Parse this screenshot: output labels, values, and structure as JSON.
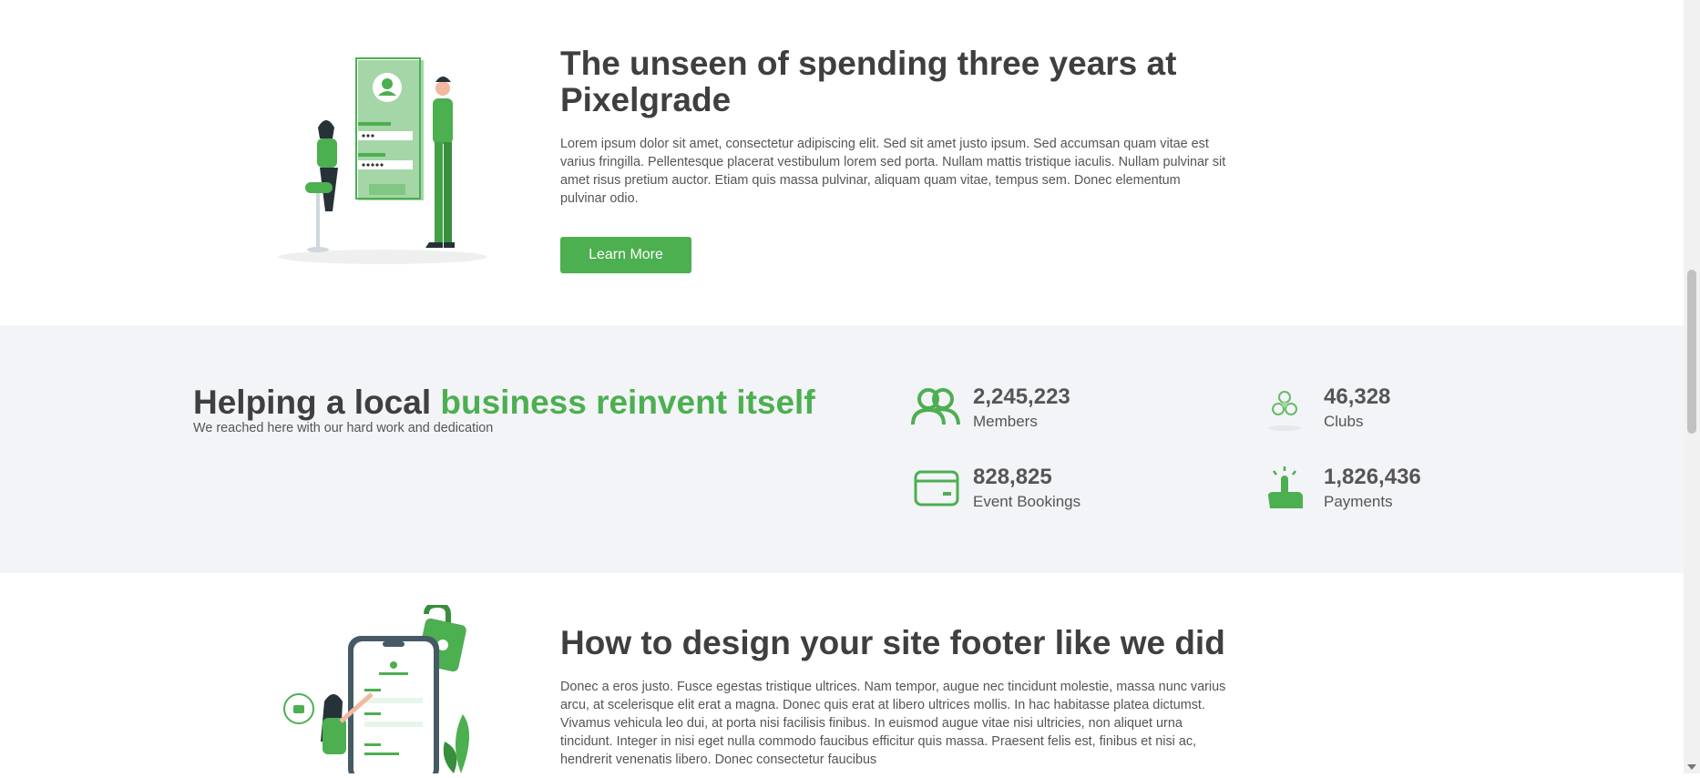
{
  "colors": {
    "accent": "#4caf50",
    "heading": "#3f3f3f",
    "band_bg": "#f3f4f7"
  },
  "section1": {
    "title": "The unseen of spending three years at Pixelgrade",
    "text": "Lorem ipsum dolor sit amet, consectetur adipiscing elit. Sed sit amet justo ipsum. Sed accumsan quam vitae est varius fringilla. Pellentesque placerat vestibulum lorem sed porta. Nullam mattis tristique iaculis. Nullam pulvinar sit amet risus pretium auctor. Etiam quis massa pulvinar, aliquam quam vitae, tempus sem. Donec elementum pulvinar odio.",
    "button_label": "Learn More",
    "illustration_icon": "login-illustration-icon"
  },
  "stats_band": {
    "title_plain": "Helping a local ",
    "title_accent": "business reinvent itself",
    "subtitle": "We reached here with our hard work and dedication",
    "stats": [
      {
        "icon": "members-icon",
        "value": "2,245,223",
        "label": "Members"
      },
      {
        "icon": "clubs-icon",
        "value": "46,328",
        "label": "Clubs"
      },
      {
        "icon": "card-icon",
        "value": "828,825",
        "label": "Event Bookings"
      },
      {
        "icon": "tap-icon",
        "value": "1,826,436",
        "label": "Payments"
      }
    ]
  },
  "section3": {
    "title": "How to design your site footer like we did",
    "text": "Donec a eros justo. Fusce egestas tristique ultrices. Nam tempor, augue nec tincidunt molestie, massa nunc varius arcu, at scelerisque elit erat a magna. Donec quis erat at libero ultrices mollis. In hac habitasse platea dictumst. Vivamus vehicula leo dui, at porta nisi facilisis finibus. In euismod augue vitae nisi ultricies, non aliquet urna tincidunt. Integer in nisi eget nulla commodo faucibus efficitur quis massa. Praesent felis est, finibus et nisi ac, hendrerit venenatis libero. Donec consectetur faucibus",
    "illustration_icon": "phone-security-illustration-icon"
  }
}
